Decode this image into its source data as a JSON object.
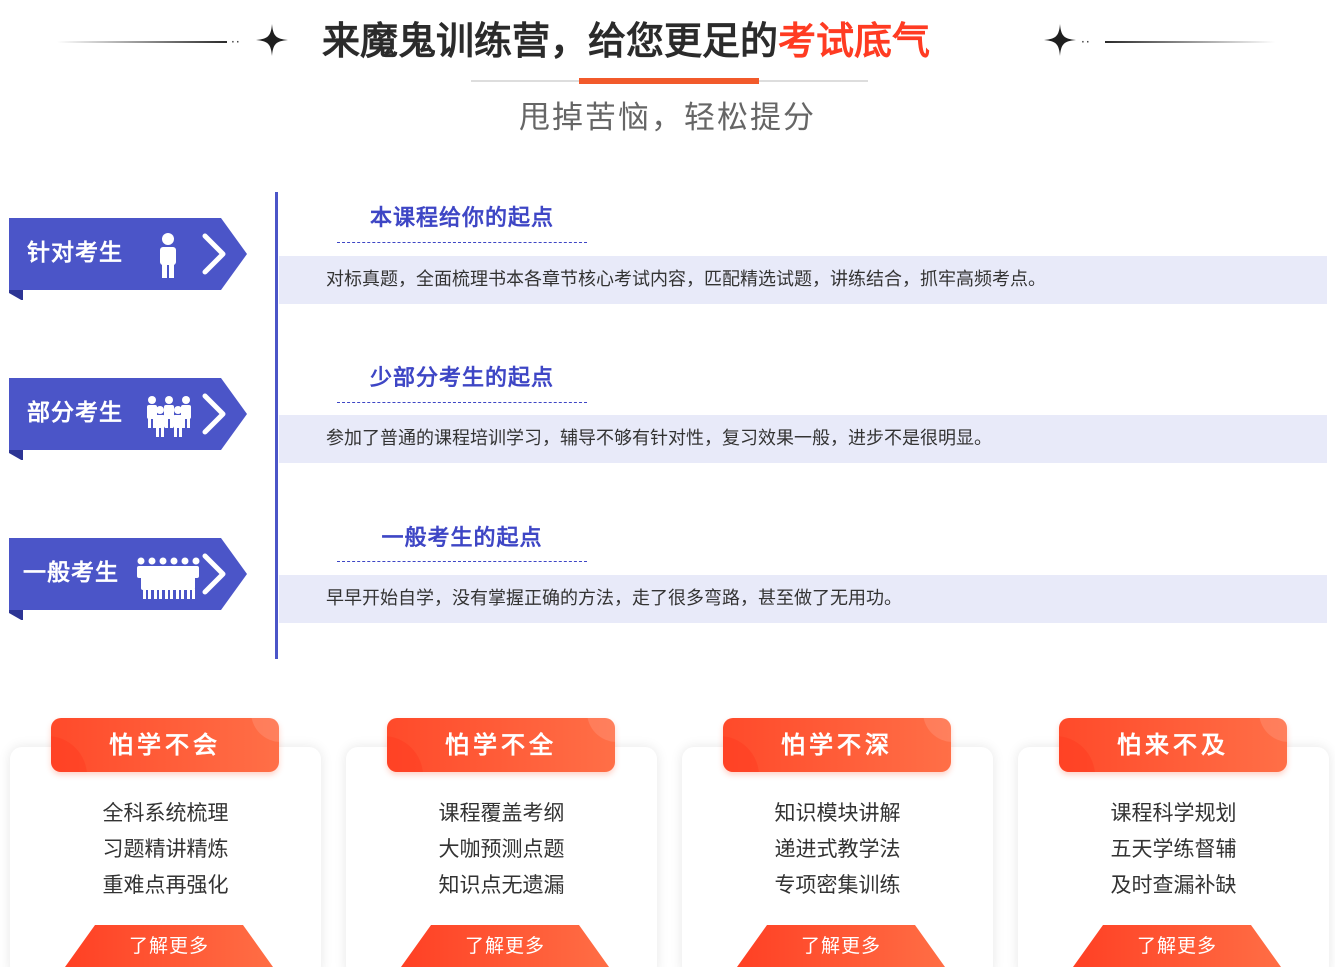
{
  "header": {
    "title_main": "来魔鬼训练营，给您更足的",
    "title_highlight": "考试底气",
    "subtitle": "甩掉苦恼，轻松提分",
    "decor_dots": "··"
  },
  "sections": [
    {
      "ribbon_label": "针对考生",
      "icon": "single-person-icon",
      "title": "本课程给你的起点",
      "description": "对标真题，全面梳理书本各章节核心考试内容，匹配精选试题，讲练结合，抓牢高频考点。"
    },
    {
      "ribbon_label": "部分考生",
      "icon": "small-group-icon",
      "title": "少部分考生的起点",
      "description": "参加了普通的课程培训学习，辅导不够有针对性，复习效果一般，进步不是很明显。"
    },
    {
      "ribbon_label": "一般考生",
      "icon": "large-group-icon",
      "title": "一般考生的起点",
      "description": "早早开始自学，没有掌握正确的方法，走了很多弯路，甚至做了无用功。"
    }
  ],
  "cards": [
    {
      "title": "怕学不会",
      "lines": [
        "全科系统梳理",
        "习题精讲精炼",
        "重难点再强化"
      ],
      "button": "了解更多"
    },
    {
      "title": "怕学不全",
      "lines": [
        "课程覆盖考纲",
        "大咖预测点题",
        "知识点无遗漏"
      ],
      "button": "了解更多"
    },
    {
      "title": "怕学不深",
      "lines": [
        "知识模块讲解",
        "递进式教学法",
        "专项密集训练"
      ],
      "button": "了解更多"
    },
    {
      "title": "怕来不及",
      "lines": [
        "课程科学规划",
        "五天学练督辅",
        "及时查漏补缺"
      ],
      "button": "了解更多"
    }
  ],
  "colors": {
    "accent_blue": "#4b55c8",
    "title_blue": "#3e46c5",
    "accent_red": "#ff3b22",
    "bar_bg": "#e8eaf9"
  }
}
